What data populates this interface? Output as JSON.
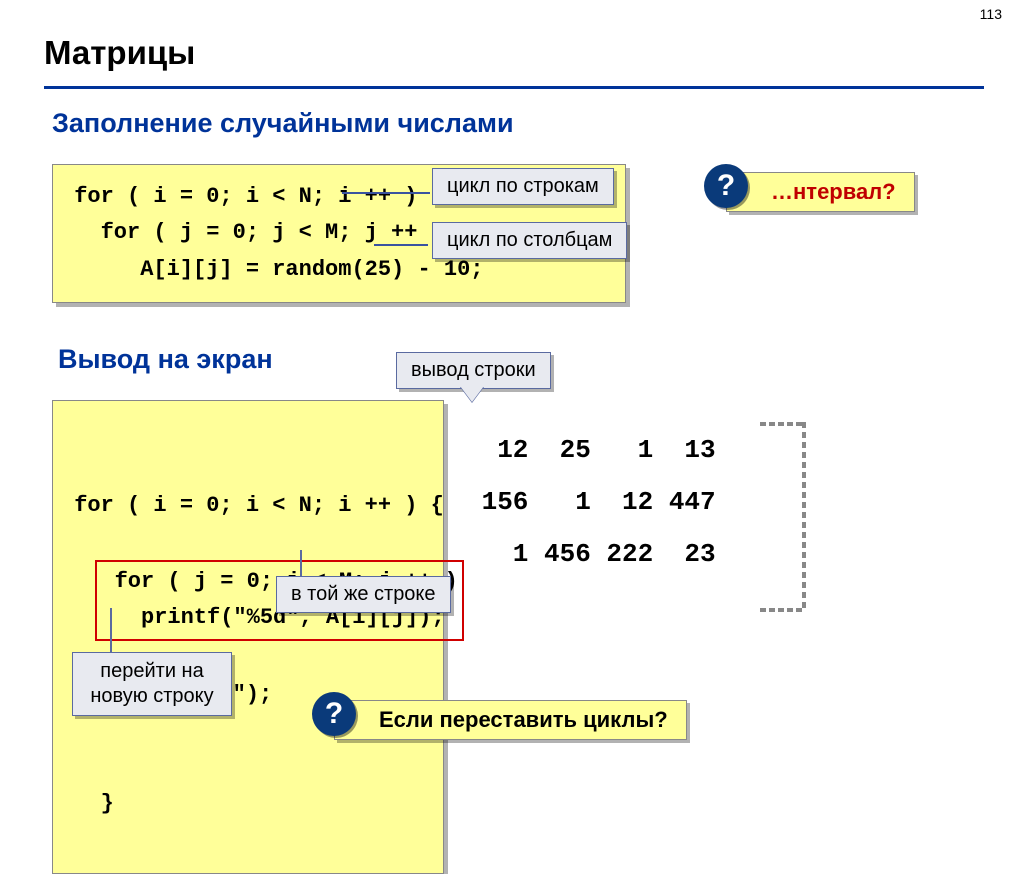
{
  "page_number": "113",
  "title": "Матрицы",
  "section1": "Заполнение случайными числами",
  "section2": "Вывод на экран",
  "code1": " for ( i = 0; i < N; i ++ )\n   for ( j = 0; j < M; j ++ )\n      A[i][j] = random(25) - 10;",
  "code2": {
    "l1": " for ( i = 0; i < N; i ++ ) {",
    "l2a": " for ( j = 0; j < M; j ++ )",
    "l2b": "   printf(\"%5d\", A[i][j]);",
    "l3": "   printf(\"\\n\");",
    "l4": "   }"
  },
  "callouts": {
    "rows": "цикл по строкам",
    "cols": "цикл по столбцам",
    "line_output": "вывод строки",
    "same_line": "в той же строке",
    "newline": "перейти на\nновую строку"
  },
  "interval_question": "…нтервал?",
  "swap_question": "Если переставить циклы?",
  "qmark": "?",
  "matrix_text": "  12  25   1  13\n 156   1  12 447\n   1 456 222  23"
}
